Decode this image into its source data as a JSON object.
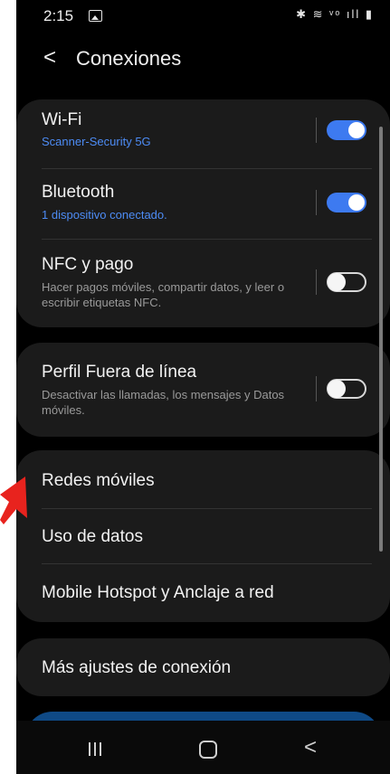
{
  "status_bar": {
    "time": "2:15",
    "icons": "✱ ≋ ᵛᵒ ıll ▮"
  },
  "header": {
    "title": "Conexiones"
  },
  "rows": {
    "wifi": {
      "title": "Wi-Fi",
      "subtitle": "Scanner-Security 5G",
      "state": "on"
    },
    "bluetooth": {
      "title": "Bluetooth",
      "subtitle": "1 dispositivo conectado.",
      "state": "on"
    },
    "nfc": {
      "title": "NFC y pago",
      "subtitle": "Hacer pagos móviles, compartir datos, y leer o escribir etiquetas NFC.",
      "state": "off"
    },
    "airplane": {
      "title": "Perfil Fuera de línea",
      "subtitle": "Desactivar las llamadas, los mensajes y Datos móviles.",
      "state": "off"
    },
    "mobile_networks": {
      "title": "Redes móviles"
    },
    "data_usage": {
      "title": "Uso de datos"
    },
    "hotspot": {
      "title": "Mobile Hotspot y Anclaje a red"
    },
    "more": {
      "title": "Más ajustes de conexión"
    }
  },
  "colors": {
    "accent": "#3d7af0",
    "subtitle_blue": "#4d8cf5",
    "card": "#1b1b1b",
    "arrow": "#e8231e"
  },
  "icons": [
    "gallery-icon",
    "back-arrow-icon",
    "recent-apps-icon",
    "home-icon",
    "nav-back-icon",
    "pointer-arrow-icon"
  ]
}
